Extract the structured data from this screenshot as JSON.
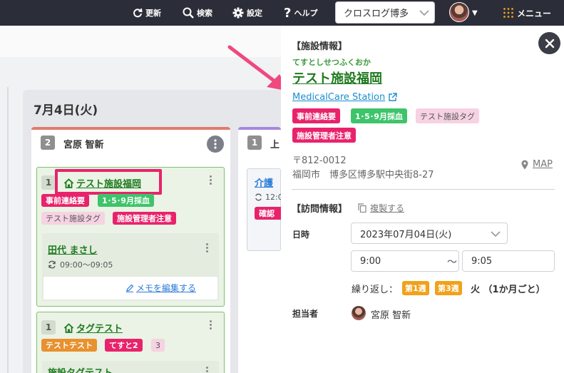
{
  "topbar": {
    "refresh_label": "更新",
    "search_label": "検索",
    "settings_label": "設定",
    "help_label": "ヘルプ",
    "office_select_value": "クロスログ博多",
    "menu_label": "メニュー",
    "avatar_caret": "▼"
  },
  "board": {
    "day_title": "7月4日(火)",
    "columns": [
      {
        "count": "2",
        "staff": "宮原 智新",
        "cards": [
          {
            "num": "1",
            "facility": "テスト施設福岡",
            "tags": [
              "事前連絡要",
              "1･5･9月採血",
              "テスト施設タグ",
              "施設管理者注意"
            ],
            "patient": "田代 まさし",
            "time": "09:00〜09:05",
            "memo_label": "メモを編集する"
          },
          {
            "num": "1",
            "facility": "タグテスト",
            "tags": [
              "テストテスト",
              "てすと2",
              "3"
            ],
            "patient": "施設タグテスト"
          }
        ]
      },
      {
        "count": "1",
        "staff": "上",
        "card_title": "介護",
        "card_time": "12:0",
        "card_tag": "確認"
      }
    ]
  },
  "panel": {
    "section_facility": "【施設情報】",
    "facility_kana": "てすとしせつふくおか",
    "facility_name": "テスト施設福岡",
    "external_link": "MedicalCare Station",
    "tags": [
      "事前連絡要",
      "1･5･9月採血",
      "テスト施設タグ",
      "施設管理者注意"
    ],
    "postal": "〒812-0012",
    "address": "福岡市　博多区博多駅中央街8-27",
    "map_label": "MAP",
    "section_visit": "【訪問情報】",
    "copy_label": "複製する",
    "datetime_label": "日時",
    "date_value": "2023年07月04日(火)",
    "start_time": "9:00",
    "tilde": "〜",
    "end_time": "9:05",
    "repeat_label": "繰り返し：",
    "week_tags": [
      "第1週",
      "第3週"
    ],
    "repeat_rule": "火 （1か月ごと）",
    "assignee_label": "担当者",
    "assignee_name": "宮原 智新"
  },
  "colors": {
    "topbar": "#2b2d38",
    "tag_red": "#e8236b",
    "tag_green": "#3ec46a",
    "tag_orange": "#e8912e",
    "week_orange": "#f0a21b",
    "link_green": "#1f7a1f",
    "link_blue": "#1a8fcf",
    "annotation_pink": "#f0487f"
  },
  "icons": [
    "refresh-icon",
    "search-icon",
    "gear-icon",
    "question-icon",
    "grid-menu-icon",
    "home-icon",
    "external-link-icon",
    "map-pin-icon",
    "copy-icon",
    "pencil-icon",
    "close-icon",
    "calendar-sync-icon"
  ]
}
